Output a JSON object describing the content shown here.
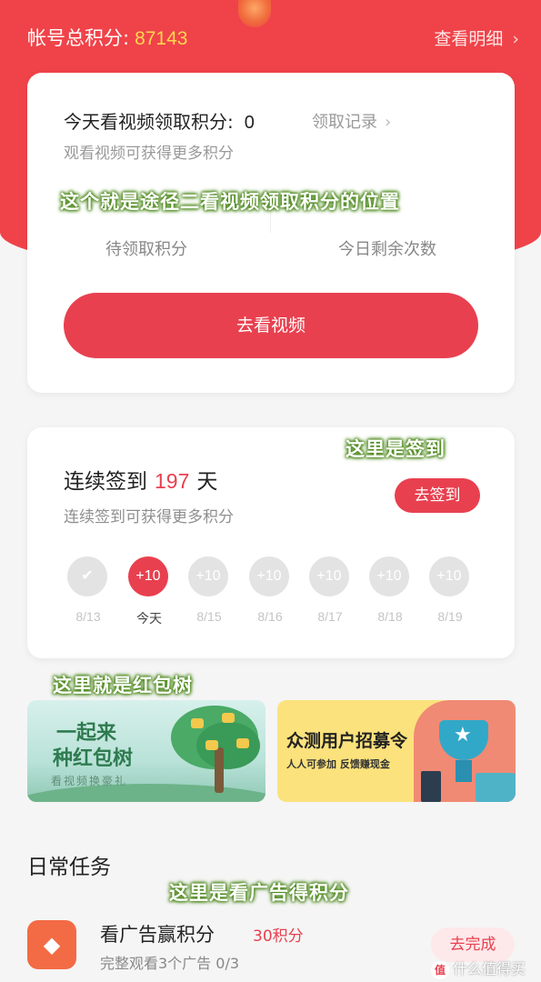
{
  "header": {
    "total_label": "帐号总积分:",
    "total_value": "87143",
    "detail_link": "查看明细",
    "chevron": "›"
  },
  "video_card": {
    "title": "今天看视频领取积分:",
    "points": "0",
    "records_link": "领取记录",
    "subtitle": "观看视频可获得更多积分",
    "stat_left_label": "待领取积分",
    "stat_right_label": "今日剩余次数",
    "button": "去看视频"
  },
  "overlays": {
    "video": "这个就是途径二看视频领取积分的位置",
    "signin": "这里是签到",
    "tree": "这里就是红包树",
    "ads": "这里是看广告得积分"
  },
  "signin_card": {
    "title_prefix": "连续签到",
    "days": "197",
    "title_suffix": "天",
    "subtitle": "连续签到可获得更多积分",
    "button": "去签到",
    "days_list": [
      {
        "badge": "✔",
        "date": "8/13",
        "state": "done"
      },
      {
        "badge": "+10",
        "date": "今天",
        "state": "today"
      },
      {
        "badge": "+10",
        "date": "8/15",
        "state": "future"
      },
      {
        "badge": "+10",
        "date": "8/16",
        "state": "future"
      },
      {
        "badge": "+10",
        "date": "8/17",
        "state": "future"
      },
      {
        "badge": "+10",
        "date": "8/18",
        "state": "future"
      },
      {
        "badge": "+10",
        "date": "8/19",
        "state": "future"
      }
    ]
  },
  "banners": {
    "left_line1": "一起来",
    "left_line2": "种红包树",
    "left_tagline": "看视频换豪礼",
    "right_title": "众测用户招募令",
    "right_sub": "人人可参加 反馈赚现金"
  },
  "daily": {
    "title": "日常任务",
    "task_name": "看广告赢积分",
    "task_reward": "30积分",
    "task_desc": "完整观看3个广告 0/3",
    "task_button": "去完成",
    "task_icon": "diamond-icon"
  },
  "watermark": {
    "logo": "值",
    "text": "什么值得买"
  },
  "colors": {
    "primary_red": "#e8404f",
    "header_red": "#ef4349",
    "gold": "#ffd54f",
    "task_orange": "#f36b45"
  }
}
